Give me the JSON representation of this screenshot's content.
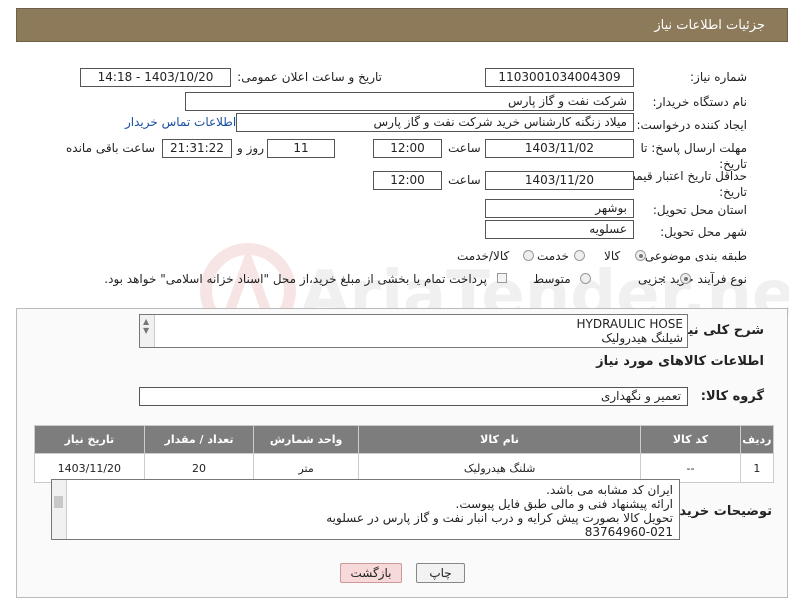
{
  "header": {
    "title": "جزئیات اطلاعات نیاز"
  },
  "form": {
    "need_number": {
      "label": "شماره نیاز:",
      "value": "1103001034004309"
    },
    "announce_datetime": {
      "label": "تاریخ و ساعت اعلان عمومی:",
      "value": "1403/10/20 - 14:18"
    },
    "buyer_org": {
      "label": "نام دستگاه خریدار:",
      "value": "شرکت نفت و گاز پارس"
    },
    "requester": {
      "label": "ایجاد کننده درخواست:",
      "value": "میلاد زنگنه کارشناس خرید شرکت نفت و گاز پارس",
      "contact_link": "اطلاعات تماس خریدار"
    },
    "send_deadline": {
      "label": "مهلت ارسال پاسخ: تا تاریخ:",
      "date": "1403/11/02",
      "time_label": "ساعت",
      "time": "12:00",
      "days": "11",
      "days_label": "روز و",
      "remaining": "21:31:22",
      "remaining_label": "ساعت باقی مانده"
    },
    "price_validity": {
      "label": "حداقل تاریخ اعتبار قیمت: تا تاریخ:",
      "date": "1403/11/20",
      "time_label": "ساعت",
      "time": "12:00"
    },
    "province": {
      "label": "استان محل تحویل:",
      "value": "بوشهر"
    },
    "city": {
      "label": "شهر محل تحویل:",
      "value": "عسلویه"
    },
    "category": {
      "label": "طبقه بندی موضوعی:",
      "options": [
        "کالا",
        "خدمت",
        "کالا/خدمت"
      ],
      "selected": "کالا"
    },
    "process": {
      "label": "نوع فرآیند خرید :",
      "options": [
        "جزیی",
        "متوسط"
      ],
      "selected": "جزیی",
      "note": "پرداخت تمام یا بخشی از مبلغ خرید،از محل \"اسناد خزانه اسلامی\" خواهد بود."
    }
  },
  "description": {
    "label": "شرح کلی نیاز:",
    "lines": [
      "HYDRAULIC HOSE",
      "شیلنگ هیدرولیک"
    ]
  },
  "goods_section": {
    "title": "اطلاعات کالاهای مورد نیاز"
  },
  "goods_group": {
    "label": "گروه کالا:",
    "value": "تعمیر و نگهداری"
  },
  "table": {
    "headers": [
      "ردیف",
      "کد کالا",
      "نام کالا",
      "واحد شمارش",
      "تعداد / مقدار",
      "تاریخ نیاز"
    ],
    "rows": [
      [
        "1",
        "--",
        "شلنگ هیدرولیک",
        "متر",
        "20",
        "1403/11/20"
      ]
    ]
  },
  "buyer_notes": {
    "label": "توضیحات خریدار:",
    "lines": [
      "ایران کد مشابه می باشد.",
      "ارائه پیشنهاد فنی و مالی طبق فایل پیوست.",
      "تحویل کالا بصورت پیش کرایه و درب انبار نفت و گاز پارس در عسلویه",
      "83764960-021"
    ]
  },
  "buttons": {
    "print": "چاپ",
    "back": "بازگشت"
  },
  "watermark": {
    "text": "AriaTender.net"
  },
  "colors": {
    "header_bg": "#8c7a5a",
    "table_header_bg": "#7d7d7d",
    "link": "#1a4fa0",
    "back_button_bg": "#f7d9d9"
  }
}
